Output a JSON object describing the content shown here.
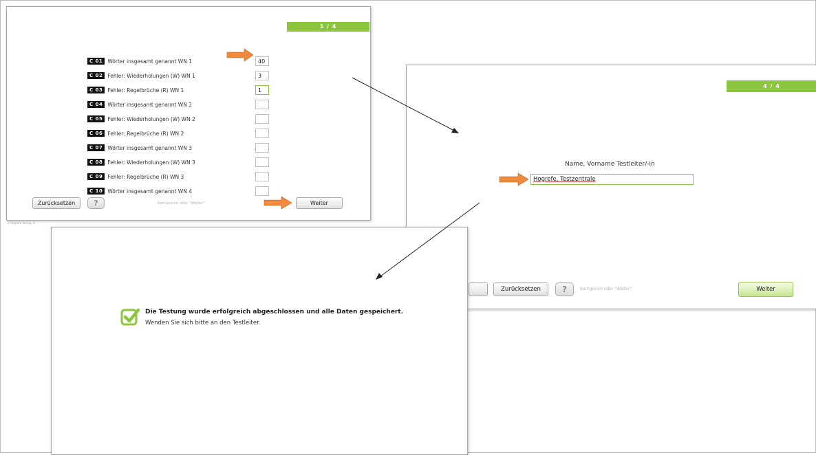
{
  "screen1": {
    "progress": "1 / 4",
    "rows": [
      {
        "code": "C 01",
        "label": "Wörter insgesamt genannt WN 1",
        "value": "40"
      },
      {
        "code": "C 02",
        "label": "Fehler: Wiederholungen (W) WN 1",
        "value": "3"
      },
      {
        "code": "C 03",
        "label": "Fehler: Regelbrüche (R) WN 1",
        "value": "1"
      },
      {
        "code": "C 04",
        "label": "Wörter insgesamt genannt WN 2",
        "value": ""
      },
      {
        "code": "C 05",
        "label": "Fehler: Wiederholungen (W) WN 2",
        "value": ""
      },
      {
        "code": "C 06",
        "label": "Fehler: Regelbrüche (R) WN 2",
        "value": ""
      },
      {
        "code": "C 07",
        "label": "Wörter insgesamt genannt WN 3",
        "value": ""
      },
      {
        "code": "C 08",
        "label": "Fehler: Wiederholungen (W) WN 3",
        "value": ""
      },
      {
        "code": "C 09",
        "label": "Fehler: Regelbrüche (R) WN 3",
        "value": ""
      },
      {
        "code": "C 10",
        "label": "Wörter insgesamt genannt WN 4",
        "value": ""
      }
    ],
    "reset_label": "Zurücksetzen",
    "help_label": "?",
    "hint": "Korrigieren oder \"Weiter\"",
    "next_label": "Weiter",
    "copyright": "© Hogrefe Verlag, G"
  },
  "screen2": {
    "progress": "4 / 4",
    "field_label": "Name, Vorname Testleiter/-in",
    "field_value": "Hogrefe, Testzentrale",
    "reset_label": "Zurücksetzen",
    "help_label": "?",
    "hint": "Korrigieren oder \"Weiter\"",
    "next_label": "Weiter"
  },
  "screen3": {
    "title": "Die Testung wurde erfolgreich abgeschlossen und alle Daten gespeichert.",
    "subtitle": "Wenden Sie sich bitte an den Testleiter."
  },
  "colors": {
    "accent_green": "#8cc63f",
    "arrow_orange": "#f08a3c"
  },
  "icons": {
    "annotation_arrow": "orange-right-arrow",
    "success": "green-checkbox-check"
  }
}
